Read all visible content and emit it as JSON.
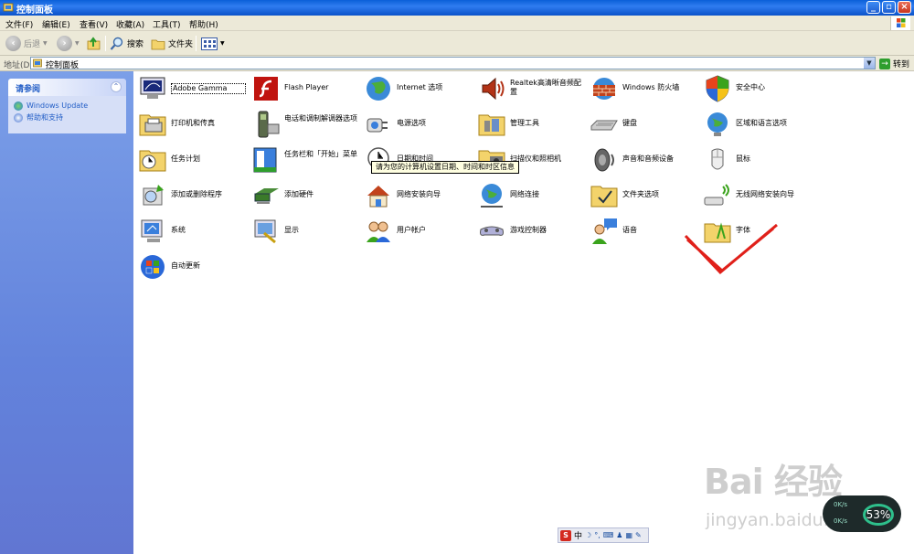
{
  "window": {
    "title": "控制面板"
  },
  "menu": [
    "文件(F)",
    "编辑(E)",
    "查看(V)",
    "收藏(A)",
    "工具(T)",
    "帮助(H)"
  ],
  "toolbar": {
    "back": "后退",
    "search": "搜索",
    "folders": "文件夹"
  },
  "address": {
    "label": "地址(D)",
    "value": "控制面板",
    "go": "转到"
  },
  "sidebar": {
    "panel_title": "请参阅",
    "links": [
      "Windows Update",
      "帮助和支持"
    ]
  },
  "items": [
    "Adobe Gamma",
    "Flash Player",
    "Internet 选项",
    "Realtek高清晰音频配置",
    "Windows 防火墙",
    "安全中心",
    "打印机和传真",
    "电话和调制解调器选项",
    "电源选项",
    "管理工具",
    "键盘",
    "区域和语言选项",
    "任务计划",
    "任务栏和「开始」菜单",
    "日期和时间",
    "扫描仪和照相机",
    "声音和音频设备",
    "鼠标",
    "添加或删除程序",
    "添加硬件",
    "网络安装向导",
    "网络连接",
    "文件夹选项",
    "无线网络安装向导",
    "系统",
    "显示",
    "用户帐户",
    "游戏控制器",
    "语音",
    "字体",
    "自动更新"
  ],
  "tooltip": "请为您的计算机设置日期、时间和时区信息",
  "ime": {
    "mode": "中"
  },
  "overlay": {
    "watermark_main": "Bai 经验",
    "watermark_url": "jingyan.baidu.com",
    "gauge_percent": "53%",
    "gauge_up": "0K/s",
    "gauge_down": "0K/s"
  },
  "colors": {
    "titlebar": "#0a5fd8",
    "sidebar": "#6383dc",
    "link": "#215dc6",
    "check": "#e0201a"
  }
}
